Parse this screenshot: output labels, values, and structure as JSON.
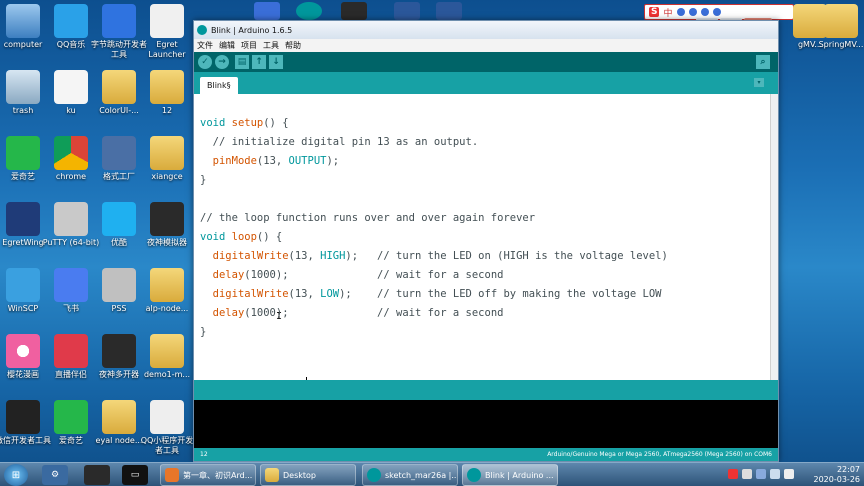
{
  "desktop_icons": [
    {
      "label": "computer",
      "icon": "computer-icon"
    },
    {
      "label": "QQ音乐",
      "icon": "qq-music-icon"
    },
    {
      "label": "字节跳动开发者工具",
      "icon": "bytedance-devtools-icon"
    },
    {
      "label": "Egret Launcher",
      "icon": "egret-launcher-icon"
    },
    {
      "label": "trash",
      "icon": "trash-icon"
    },
    {
      "label": "ku",
      "icon": "ku-icon"
    },
    {
      "label": "ColorUI-...",
      "icon": "folder-icon"
    },
    {
      "label": "12",
      "icon": "folder-icon"
    },
    {
      "label": "爱奇艺",
      "icon": "iqiyi-icon"
    },
    {
      "label": "chrome",
      "icon": "chrome-icon"
    },
    {
      "label": "格式工厂",
      "icon": "format-factory-icon"
    },
    {
      "label": "xiangce",
      "icon": "folder-icon"
    },
    {
      "label": "EgretWing",
      "icon": "egretwing-icon"
    },
    {
      "label": "PuTTY (64-bit)",
      "icon": "putty-icon"
    },
    {
      "label": "优酷",
      "icon": "youku-icon"
    },
    {
      "label": "夜神模拟器",
      "icon": "nox-icon"
    },
    {
      "label": "WinSCP",
      "icon": "winscp-icon"
    },
    {
      "label": "飞书",
      "icon": "feishu-icon"
    },
    {
      "label": "PSS",
      "icon": "pss-icon"
    },
    {
      "label": "alp-node...",
      "icon": "folder-icon"
    },
    {
      "label": "樱花漫画",
      "icon": "flower-icon"
    },
    {
      "label": "直播伴侣",
      "icon": "live-icon"
    },
    {
      "label": "夜神多开器",
      "icon": "nox-multi-icon"
    },
    {
      "label": "demo1-m...",
      "icon": "folder-icon"
    },
    {
      "label": "微信开发者工具",
      "icon": "wechat-devtools-icon"
    },
    {
      "label": "爱奇艺",
      "icon": "iqiyi-icon"
    },
    {
      "label": "eyal node...",
      "icon": "folder-icon"
    },
    {
      "label": "QQ小程序开发者工具",
      "icon": "qq-miniprogram-icon"
    }
  ],
  "window": {
    "title": "Blink | Arduino 1.6.5",
    "menu": [
      "文件",
      "编辑",
      "项目",
      "工具",
      "帮助"
    ],
    "toolbar": {
      "verify": "✓",
      "upload": "→",
      "new": "▤",
      "open": "↑",
      "save": "↓",
      "serial_monitor": "⌕"
    },
    "tab_label": "Blink§",
    "tab_menu": "▾",
    "line_number": "12",
    "board_status": "Arduino/Genuino Mega or Mega 2560, ATmega2560 (Mega 2560) on COM6"
  },
  "code": [
    {
      "parts": [
        [
          "kw",
          "void"
        ],
        [
          "tx",
          " "
        ],
        [
          "fn",
          "setup"
        ],
        [
          "tx",
          "() {"
        ]
      ]
    },
    {
      "parts": [
        [
          "cm",
          "  // initialize digital pin 13 as an output."
        ]
      ]
    },
    {
      "parts": [
        [
          "tx",
          "  "
        ],
        [
          "fn",
          "pinMode"
        ],
        [
          "tx",
          "(13, "
        ],
        [
          "kw",
          "OUTPUT"
        ],
        [
          "tx",
          ");"
        ]
      ]
    },
    {
      "parts": [
        [
          "tx",
          "}"
        ]
      ]
    },
    {
      "parts": [
        [
          "tx",
          ""
        ]
      ]
    },
    {
      "parts": [
        [
          "cm",
          "// the loop function runs over and over again forever"
        ]
      ]
    },
    {
      "parts": [
        [
          "kw",
          "void"
        ],
        [
          "tx",
          " "
        ],
        [
          "fn",
          "loop"
        ],
        [
          "tx",
          "() {"
        ]
      ]
    },
    {
      "parts": [
        [
          "tx",
          "  "
        ],
        [
          "fn",
          "digitalWrite"
        ],
        [
          "tx",
          "(13, "
        ],
        [
          "kw",
          "HIGH"
        ],
        [
          "tx",
          ");   "
        ],
        [
          "cm",
          "// turn the LED on (HIGH is the voltage level)"
        ]
      ]
    },
    {
      "parts": [
        [
          "tx",
          "  "
        ],
        [
          "fn",
          "delay"
        ],
        [
          "tx",
          "(1000);              "
        ],
        [
          "cm",
          "// wait for a second"
        ]
      ]
    },
    {
      "parts": [
        [
          "tx",
          "  "
        ],
        [
          "fn",
          "digitalWrite"
        ],
        [
          "tx",
          "(13, "
        ],
        [
          "kw",
          "LOW"
        ],
        [
          "tx",
          ");    "
        ],
        [
          "cm",
          "// turn the LED off by making the voltage LOW"
        ]
      ]
    },
    {
      "parts": [
        [
          "tx",
          "  "
        ],
        [
          "fn",
          "delay"
        ],
        [
          "tx",
          "(1000);              "
        ],
        [
          "cm",
          "// wait for a second"
        ]
      ]
    },
    {
      "parts": [
        [
          "tx",
          "}"
        ]
      ]
    }
  ],
  "ime": {
    "logo": "S",
    "lang": "中"
  },
  "window_controls": {
    "minimize": "—",
    "maximize": "□",
    "close": "✕"
  },
  "taskbar": {
    "tasks": [
      {
        "label": "第一章、初识Ard...",
        "icon": "wps-icon"
      },
      {
        "label": "Desktop",
        "icon": "folder-icon"
      },
      {
        "label": "sketch_mar26a |...",
        "icon": "arduino-icon"
      },
      {
        "label": "Blink | Arduino ...",
        "icon": "arduino-icon",
        "active": true
      }
    ],
    "time": "22:07",
    "date": "2020-03-26"
  },
  "colors": {
    "arduino_dark": "#006468",
    "arduino_teal": "#17a1a5",
    "keyword": "#00979c",
    "function": "#d35400"
  }
}
